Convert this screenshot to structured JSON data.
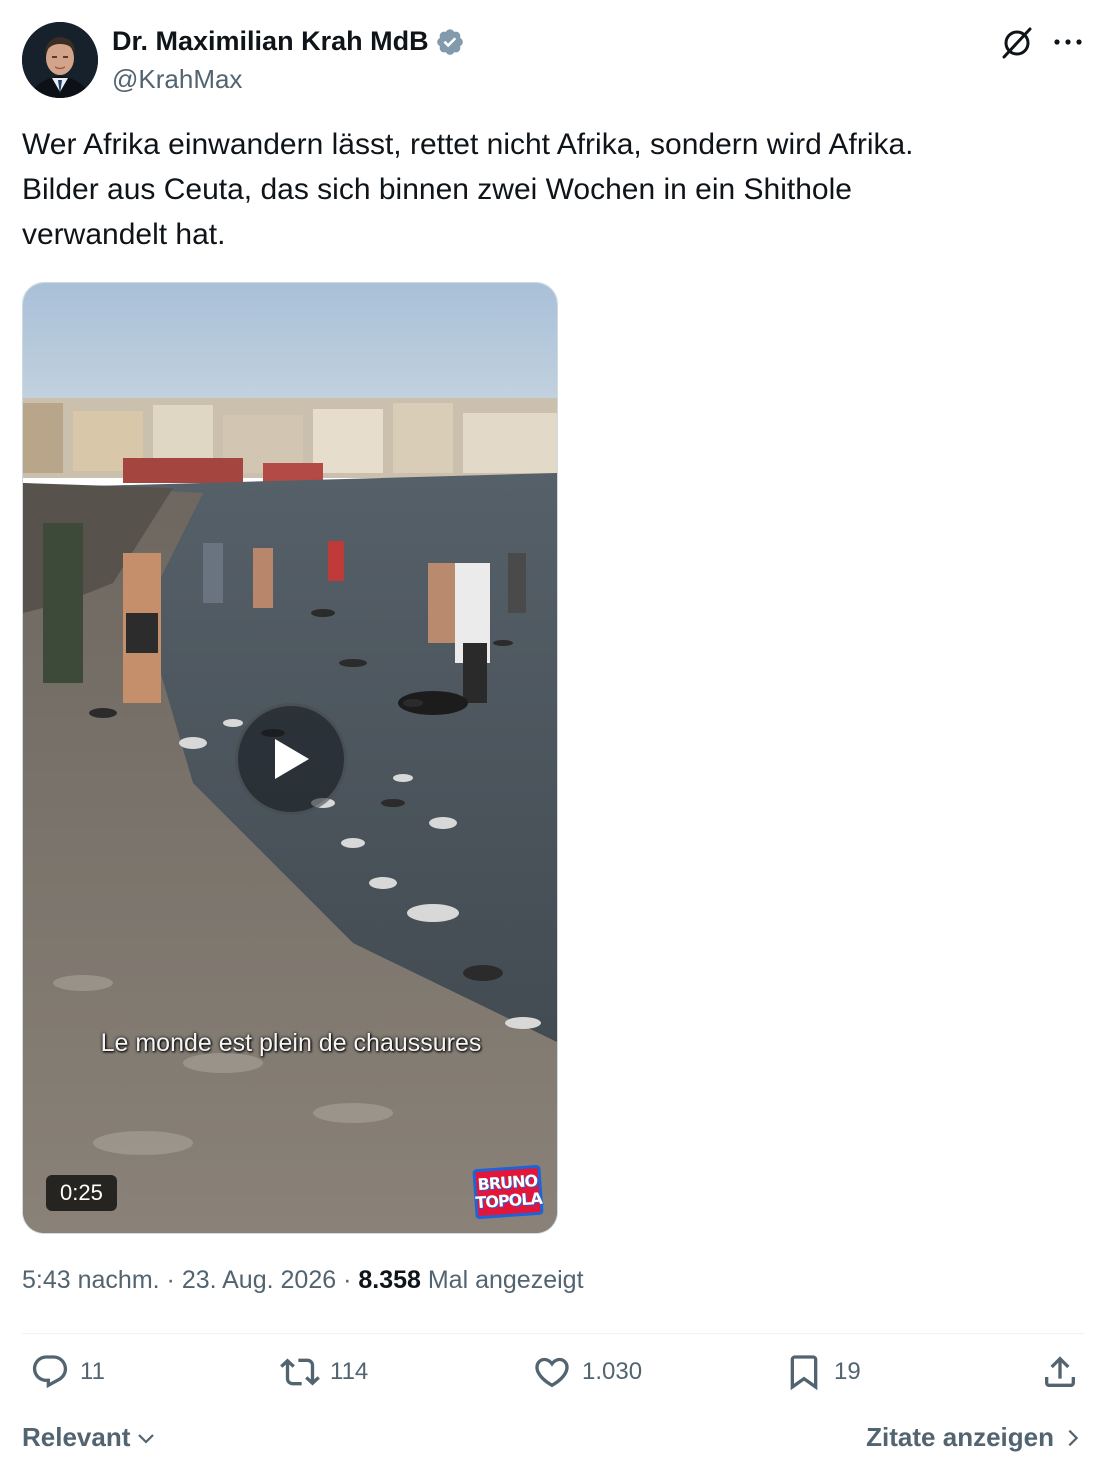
{
  "author": {
    "display_name": "Dr. Maximilian Krah MdB",
    "handle": "@KrahMax",
    "verified": true
  },
  "tweet": {
    "text_lines": [
      "Wer Afrika einwandern lässt, rettet nicht Afrika, sondern wird Afrika.",
      "Bilder aus Ceuta, das sich binnen zwei Wochen in ein Shithole",
      "verwandelt hat."
    ]
  },
  "media": {
    "type": "video",
    "subtitle": "Le monde est plein de chaussures",
    "duration": "0:25",
    "watermark_line1": "BRUNO",
    "watermark_line2": "TOPOLA"
  },
  "meta": {
    "time": "5:43 nachm.",
    "separator": " · ",
    "date": "23. Aug. 2026",
    "views_count": "8.358",
    "views_label": "Mal angezeigt"
  },
  "actions": {
    "replies": "11",
    "reposts": "114",
    "likes": "1.030",
    "bookmarks": "19"
  },
  "footer": {
    "sort_label": "Relevant",
    "quotes_label": "Zitate anzeigen"
  },
  "colors": {
    "text_primary": "#0f1419",
    "text_secondary": "#536471",
    "verified_blue": "#829aab",
    "divider": "#eff3f4"
  }
}
